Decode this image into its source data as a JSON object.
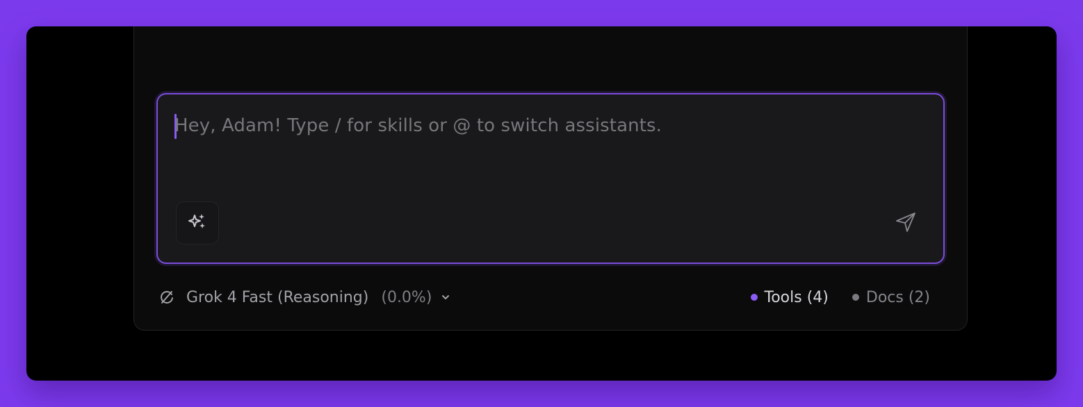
{
  "composer": {
    "placeholder": "Hey, Adam! Type / for skills or @ to switch assistants."
  },
  "footer": {
    "model_name": "Grok 4 Fast (Reasoning)",
    "model_usage": "(0.0%)",
    "tools_label": "Tools (4)",
    "docs_label": "Docs (2)"
  },
  "icons": {
    "skills": "sparkles-icon",
    "send": "send-icon",
    "model": "reload-icon",
    "dropdown": "chevron-down-icon"
  },
  "colors": {
    "accent": "#7c4ddc",
    "tools_dot": "#8b5cf6",
    "docs_dot": "#7a7a80",
    "background": "#7c3aed"
  }
}
